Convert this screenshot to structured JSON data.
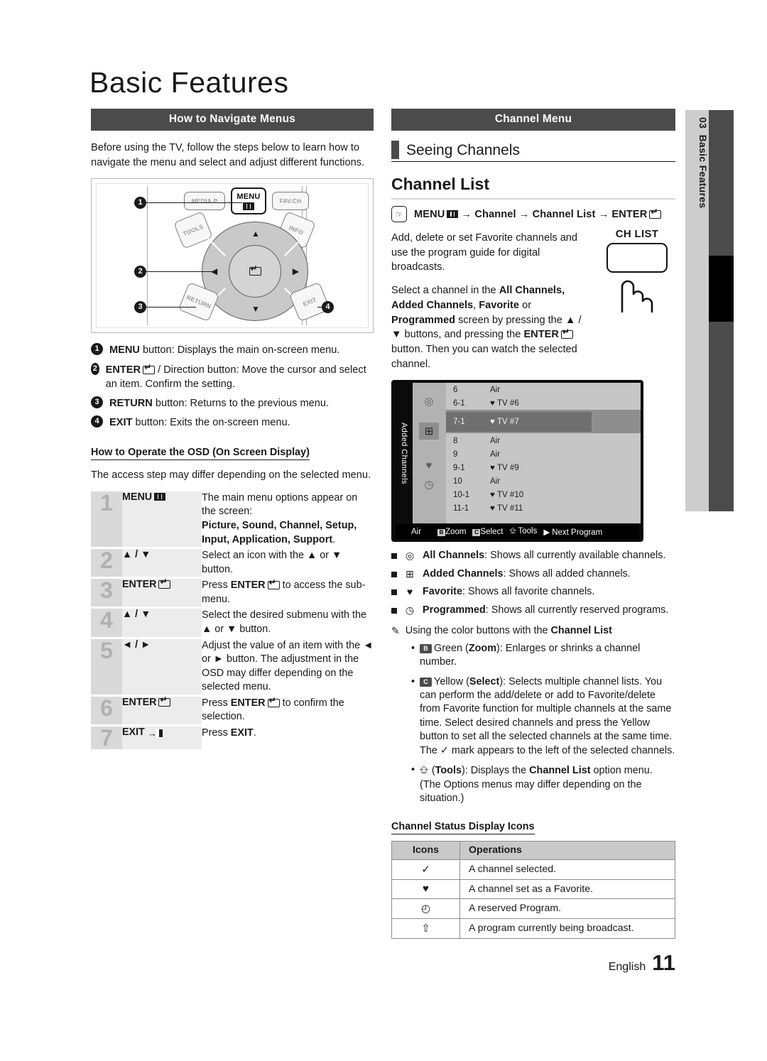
{
  "document": {
    "title": "Basic Features",
    "chapter_number": "03",
    "chapter_name": "Basic Features",
    "footer_language": "English",
    "page_number": "11"
  },
  "left_column": {
    "section_bar": "How to Navigate Menus",
    "intro": "Before using the TV, follow the steps below to learn how to navigate the menu and select and adjust different functions.",
    "remote_figure": {
      "keys": [
        {
          "label": "MEDIA.P",
          "state": "inactive"
        },
        {
          "label": "MENU",
          "state": "active"
        },
        {
          "label": "FAV.CH",
          "state": "inactive"
        },
        {
          "label": "TOOLS",
          "state": "inactive"
        },
        {
          "label": "INFO",
          "state": "inactive"
        },
        {
          "label": "RETURN",
          "state": "inactive"
        },
        {
          "label": "EXIT",
          "state": "inactive"
        }
      ],
      "callouts": [
        "1",
        "2",
        "3",
        "4"
      ]
    },
    "legend": [
      {
        "num": "1",
        "text_html": "<b>MENU</b> button: Displays the main on-screen menu."
      },
      {
        "num": "2",
        "text_html": "<b>ENTER</b><span class=\"g-enter\"></span> / Direction button: Move the cursor and select an item. Confirm the setting."
      },
      {
        "num": "3",
        "text_html": "<b>RETURN</b> button: Returns to the previous menu."
      },
      {
        "num": "4",
        "text_html": "<b>EXIT</b> button: Exits the on-screen menu."
      }
    ],
    "osd_subhead": "How to Operate the OSD (On Screen Display)",
    "osd_note": "The access step may differ depending on the selected menu.",
    "steps": [
      {
        "num": "1",
        "key_html": "MENU<span class=\"g-menu\"></span>",
        "desc_html": "The main menu options appear on the screen:<br><b>Picture, Sound, Channel, Setup, Input, Application, Support</b>."
      },
      {
        "num": "2",
        "key_html": "▲ / ▼",
        "desc_html": "Select an icon with the ▲ or ▼ button."
      },
      {
        "num": "3",
        "key_html": "ENTER<span class=\"g-enter\"></span>",
        "desc_html": "Press <b>ENTER</b><span class=\"g-enter\"></span> to access the sub-menu."
      },
      {
        "num": "4",
        "key_html": "▲ / ▼",
        "desc_html": "Select the desired submenu with the ▲ or ▼ button."
      },
      {
        "num": "5",
        "key_html": "◄ / ►",
        "desc_html": "Adjust the value of an item with the ◄ or ► button. The adjustment in the OSD may differ depending on the selected menu."
      },
      {
        "num": "6",
        "key_html": "ENTER<span class=\"g-enter\"></span>",
        "desc_html": "Press <b>ENTER</b><span class=\"g-enter\"></span> to confirm the selection."
      },
      {
        "num": "7",
        "key_html": "EXIT<span class=\"g-exit\">→<span class=\"door\"></span></span>",
        "desc_html": "Press <b>EXIT</b>."
      }
    ]
  },
  "right_column": {
    "section_bar": "Channel Menu",
    "seeing_channels": "Seeing Channels",
    "channel_list_heading": "Channel List",
    "menu_path_html": "MENU<span class=\"g-menu\"></span> → Channel → Channel List → ENTER<span class=\"g-enter\"></span>",
    "ch_list_button_label": "CH LIST",
    "body_1": "Add, delete or set Favorite channels and use the program guide for digital broadcasts.",
    "body_2_html": "Select a channel in the <b>All Channels, Added Channels</b>, <b>Favorite</b> or <b>Programmed</b> screen by pressing the ▲ / ▼ buttons, and pressing the <b>ENTER</b><span class=\"g-enter\"></span> button. Then you can watch the selected channel.",
    "tv_screen": {
      "side_label": "Added Channels",
      "sidebar_icons": [
        "all-channels-icon",
        "added-channels-icon",
        "favorite-icon",
        "programmed-icon"
      ],
      "selected_icon_index": 1,
      "rows": [
        {
          "number": "6",
          "name": "Air",
          "fav": false,
          "highlight": false
        },
        {
          "number": "6-1",
          "name": "TV #6",
          "fav": true,
          "highlight": false
        },
        {
          "number": "7-1",
          "name": "TV #7",
          "fav": true,
          "highlight": true
        },
        {
          "number": "8",
          "name": "Air",
          "fav": false,
          "highlight": false
        },
        {
          "number": "9",
          "name": "Air",
          "fav": false,
          "highlight": false
        },
        {
          "number": "9-1",
          "name": "TV #9",
          "fav": true,
          "highlight": false
        },
        {
          "number": "10",
          "name": "Air",
          "fav": false,
          "highlight": false
        },
        {
          "number": "10-1",
          "name": "TV #10",
          "fav": true,
          "highlight": false
        },
        {
          "number": "11-1",
          "name": "TV #11",
          "fav": true,
          "highlight": false
        }
      ],
      "bottom_bar": {
        "source": "Air",
        "items": [
          {
            "key": "B",
            "label": "Zoom"
          },
          {
            "key": "C",
            "label": "Select"
          },
          {
            "key": "tools",
            "label": "Tools"
          },
          {
            "key": "▶",
            "label": "Next Program"
          }
        ]
      }
    },
    "mode_list": [
      {
        "icon": "all-channels-icon",
        "text_html": "<b>All Channels</b>: Shows all currently available channels."
      },
      {
        "icon": "added-channels-icon",
        "text_html": "<b>Added Channels</b>: Shows all added channels."
      },
      {
        "icon": "favorite-icon",
        "text_html": "<b>Favorite</b>: Shows all favorite channels."
      },
      {
        "icon": "programmed-icon",
        "text_html": "<b>Programmed</b>: Shows all currently reserved programs."
      }
    ],
    "color_note_html": "Using the color buttons with the <b>Channel List</b>",
    "color_bullets": [
      {
        "key": "B",
        "text_html": "Green (<b>Zoom</b>): Enlarges or shrinks a channel number."
      },
      {
        "key": "C",
        "text_html": "Yellow (<b>Select</b>): Selects multiple channel lists. You can perform the add/delete or add to Favorite/delete from Favorite function for multiple channels at the same time. Select desired channels and press the Yellow button to set all the selected channels at the same time. The ✓ mark appears to the left of the selected channels."
      },
      {
        "key": "tools",
        "text_html": "(<b>Tools</b>): Displays the <b>Channel List</b> option menu. (The Options menus may differ depending on the situation.)"
      }
    ],
    "status_icons": {
      "heading": "Channel Status Display Icons",
      "columns": [
        "Icons",
        "Operations"
      ],
      "rows": [
        {
          "icon": "✓",
          "icon_name": "check-icon",
          "operation": "A channel selected."
        },
        {
          "icon": "♥",
          "icon_name": "heart-icon",
          "operation": "A channel set as a Favorite."
        },
        {
          "icon": "◴",
          "icon_name": "clock-icon",
          "operation": "A reserved Program."
        },
        {
          "icon": "⇧",
          "icon_name": "broadcast-icon",
          "operation": "A program currently being broadcast."
        }
      ]
    }
  }
}
